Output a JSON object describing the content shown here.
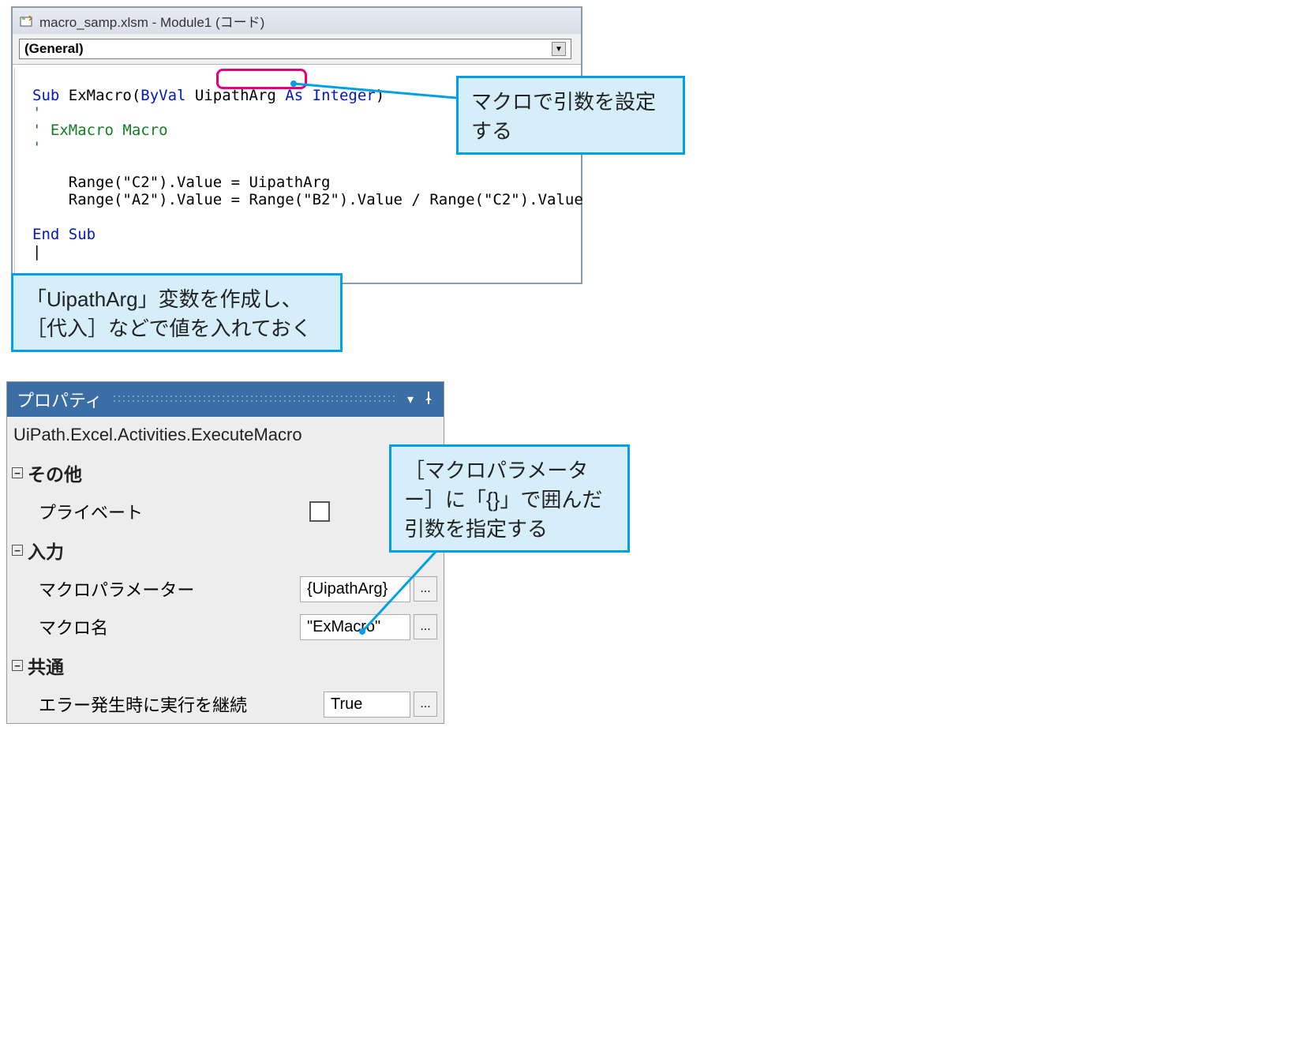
{
  "vba": {
    "title": "macro_samp.xlsm - Module1 (コード)",
    "dropdown": "(General)",
    "code": {
      "sub": "Sub",
      "funcname": " ExMacro(",
      "byval": "ByVal",
      "argname": " UipathArg ",
      "as": "As Integer",
      "close": ")",
      "comment_tick1": "'",
      "comment_tick2": "'",
      "comment2": " ExMacro Macro",
      "comment_tick3": "'",
      "line1": "    Range(\"C2\").Value = UipathArg",
      "line2": "    Range(\"A2\").Value = Range(\"B2\").Value / Range(\"C2\").Value",
      "endsub": "End Sub"
    }
  },
  "callouts": {
    "c1": "マクロで引数を設定する",
    "c2": "「UipathArg」変数を作成し、［代入］などで値を入れておく",
    "c3": "［マクロパラメーター］に「{}」で囲んだ引数を指定する"
  },
  "props": {
    "panel_title": "プロパティ",
    "activity_path": "UiPath.Excel.Activities.ExecuteMacro",
    "groups": {
      "other": "その他",
      "input": "入力",
      "common": "共通"
    },
    "rows": {
      "private": "プライベート",
      "macro_param_label": "マクロパラメーター",
      "macro_param_value": "{UipathArg}",
      "macro_name_label": "マクロ名",
      "macro_name_value": "\"ExMacro\"",
      "continue_on_error_label": "エラー発生時に実行を継続",
      "continue_on_error_value": "True"
    }
  },
  "icons": {
    "ellipsis": "...",
    "minus": "−",
    "dropdown_arrow": "▼",
    "pin": "📌",
    "collapse_arrow": "▾"
  }
}
